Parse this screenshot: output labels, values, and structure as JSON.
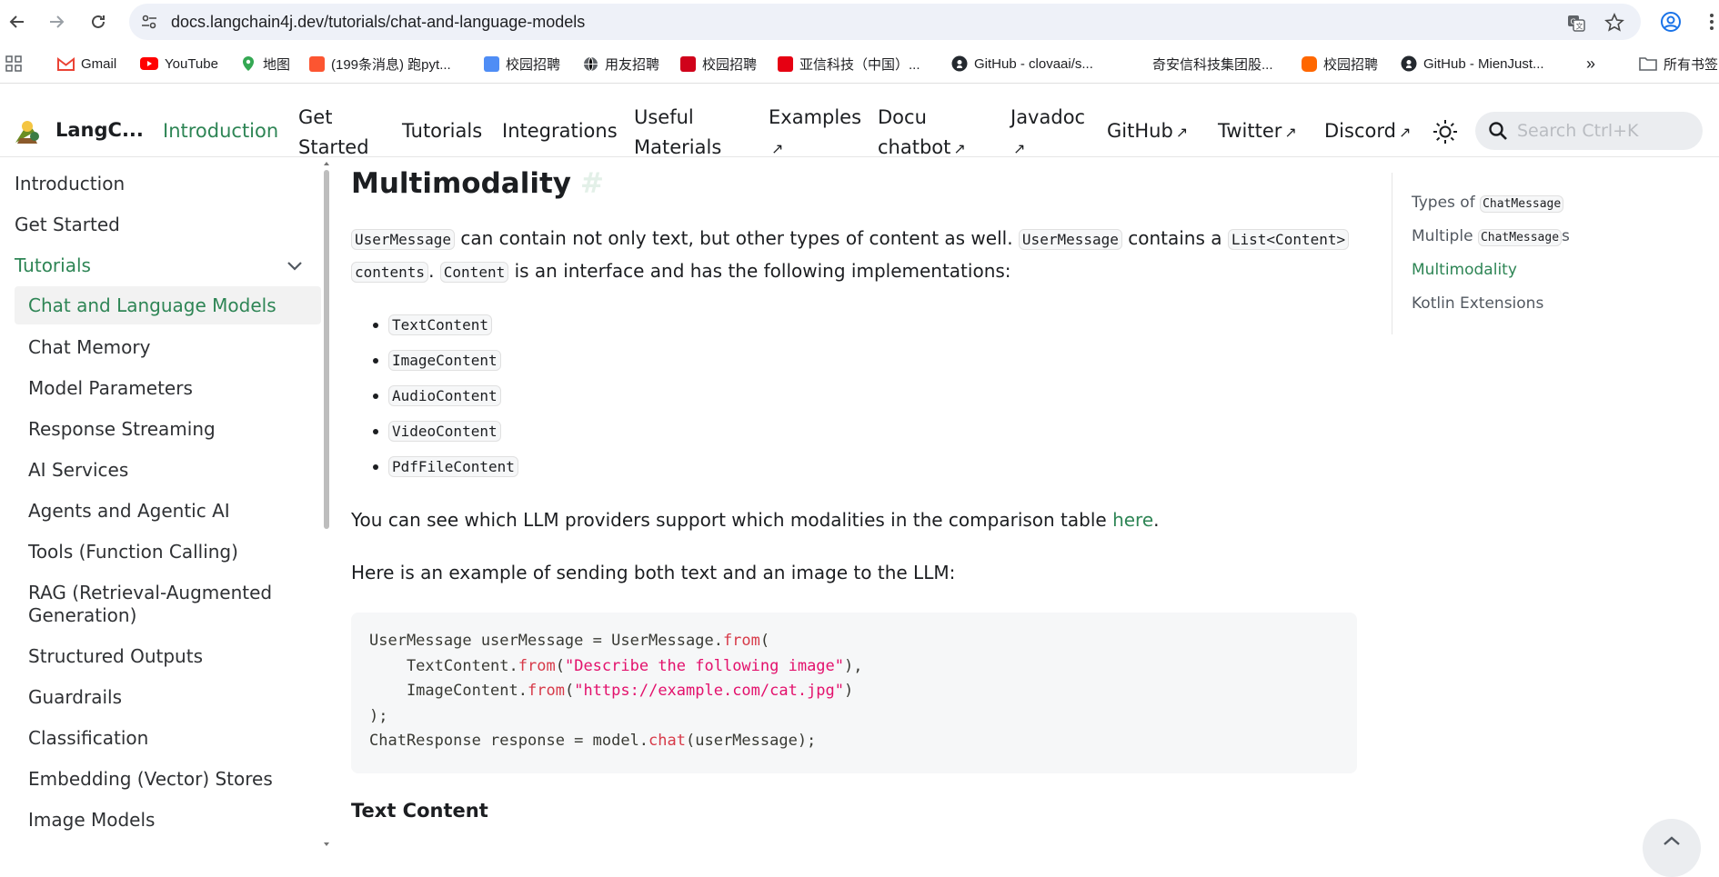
{
  "browser": {
    "url": "docs.langchain4j.dev/tutorials/chat-and-language-models",
    "bookmarks": [
      {
        "label": "Gmail",
        "color": "#ea4335"
      },
      {
        "label": "YouTube",
        "color": "#ff0000"
      },
      {
        "label": "地图",
        "color": "#34a853"
      },
      {
        "label": "(199条消息) 跑pyt...",
        "color": "#fc5531"
      },
      {
        "label": "校园招聘",
        "color": "#4f8df5"
      },
      {
        "label": "用友招聘",
        "color": "#5f6368"
      },
      {
        "label": "校园招聘",
        "color": "#d0021b"
      },
      {
        "label": "亚信科技（中国）...",
        "color": "#e60012"
      },
      {
        "label": "GitHub - clovaai/s...",
        "color": "#24292f"
      },
      {
        "label": "奇安信科技集团股...",
        "color": "#ffffff"
      },
      {
        "label": "校园招聘",
        "color": "#ff6700"
      },
      {
        "label": "GitHub - MienJust...",
        "color": "#24292f"
      },
      {
        "label": "所有书签",
        "color": "#5f6368"
      }
    ],
    "overflow": "»"
  },
  "header": {
    "brand": "LangC...",
    "nav": [
      {
        "label": "Introduction",
        "active": true
      },
      {
        "label": "Get",
        "label2": "Started"
      },
      {
        "label": "Tutorials"
      },
      {
        "label": "Integrations"
      },
      {
        "label": "Useful",
        "label2": "Materials"
      },
      {
        "label": "Examples",
        "ext": true
      },
      {
        "label": "Docu",
        "label2": "chatbot",
        "ext": true
      },
      {
        "label": "Javadoc",
        "ext": true
      },
      {
        "label": "GitHub",
        "ext": true
      },
      {
        "label": "Twitter",
        "ext": true
      },
      {
        "label": "Discord",
        "ext": true
      }
    ],
    "search_placeholder": "Search Ctrl+K"
  },
  "sidebar": {
    "items": [
      {
        "label": "Introduction"
      },
      {
        "label": "Get Started"
      },
      {
        "label": "Tutorials"
      },
      {
        "label": "Chat and Language Models"
      },
      {
        "label": "Chat Memory"
      },
      {
        "label": "Model Parameters"
      },
      {
        "label": "Response Streaming"
      },
      {
        "label": "AI Services"
      },
      {
        "label": "Agents and Agentic AI"
      },
      {
        "label": "Tools (Function Calling)"
      },
      {
        "label": "RAG (Retrieval-Augmented",
        "label2": "Generation)"
      },
      {
        "label": "Structured Outputs"
      },
      {
        "label": "Guardrails"
      },
      {
        "label": "Classification"
      },
      {
        "label": "Embedding (Vector) Stores"
      },
      {
        "label": "Image Models"
      }
    ]
  },
  "content": {
    "title": "Multimodality",
    "hash": "#",
    "intro": {
      "c1": "UserMessage",
      "t1": " can contain not only text, but other types of content as well. ",
      "c2": "UserMessage",
      "t2": " contains a ",
      "c3": "List<Content>",
      "c4": "contents",
      "t3": ". ",
      "c5": "Content",
      "t4": " is an interface and has the following implementations:"
    },
    "implementations": [
      "TextContent",
      "ImageContent",
      "AudioContent",
      "VideoContent",
      "PdfFileContent"
    ],
    "providers_text": "You can see which LLM providers support which modalities in the comparison table ",
    "providers_link": "here",
    "providers_end": ".",
    "example_text": "Here is an example of sending both text and an image to the LLM:",
    "code": {
      "l1a": "UserMessage userMessage = UserMessage.",
      "l1b": "from",
      "l1c": "(",
      "l2a": "    TextContent.",
      "l2b": "from",
      "l2c": "(",
      "l2d": "\"Describe the following image\"",
      "l2e": "),",
      "l3a": "    ImageContent.",
      "l3b": "from",
      "l3c": "(",
      "l3d": "\"https://example.com/cat.jpg\"",
      "l3e": ")",
      "l4": ");",
      "l5a": "ChatResponse response = model.",
      "l5b": "chat",
      "l5c": "(userMessage);"
    },
    "next_heading": "Text Content"
  },
  "toc": {
    "i1_text": "Types of ",
    "i1_code": "ChatMessage",
    "i2_text": "Multiple ",
    "i2_code": "ChatMessage",
    "i2_tail": "s",
    "i3": "Multimodality",
    "i4": "Kotlin Extensions"
  },
  "colors": {
    "accent": "#2e8555"
  }
}
